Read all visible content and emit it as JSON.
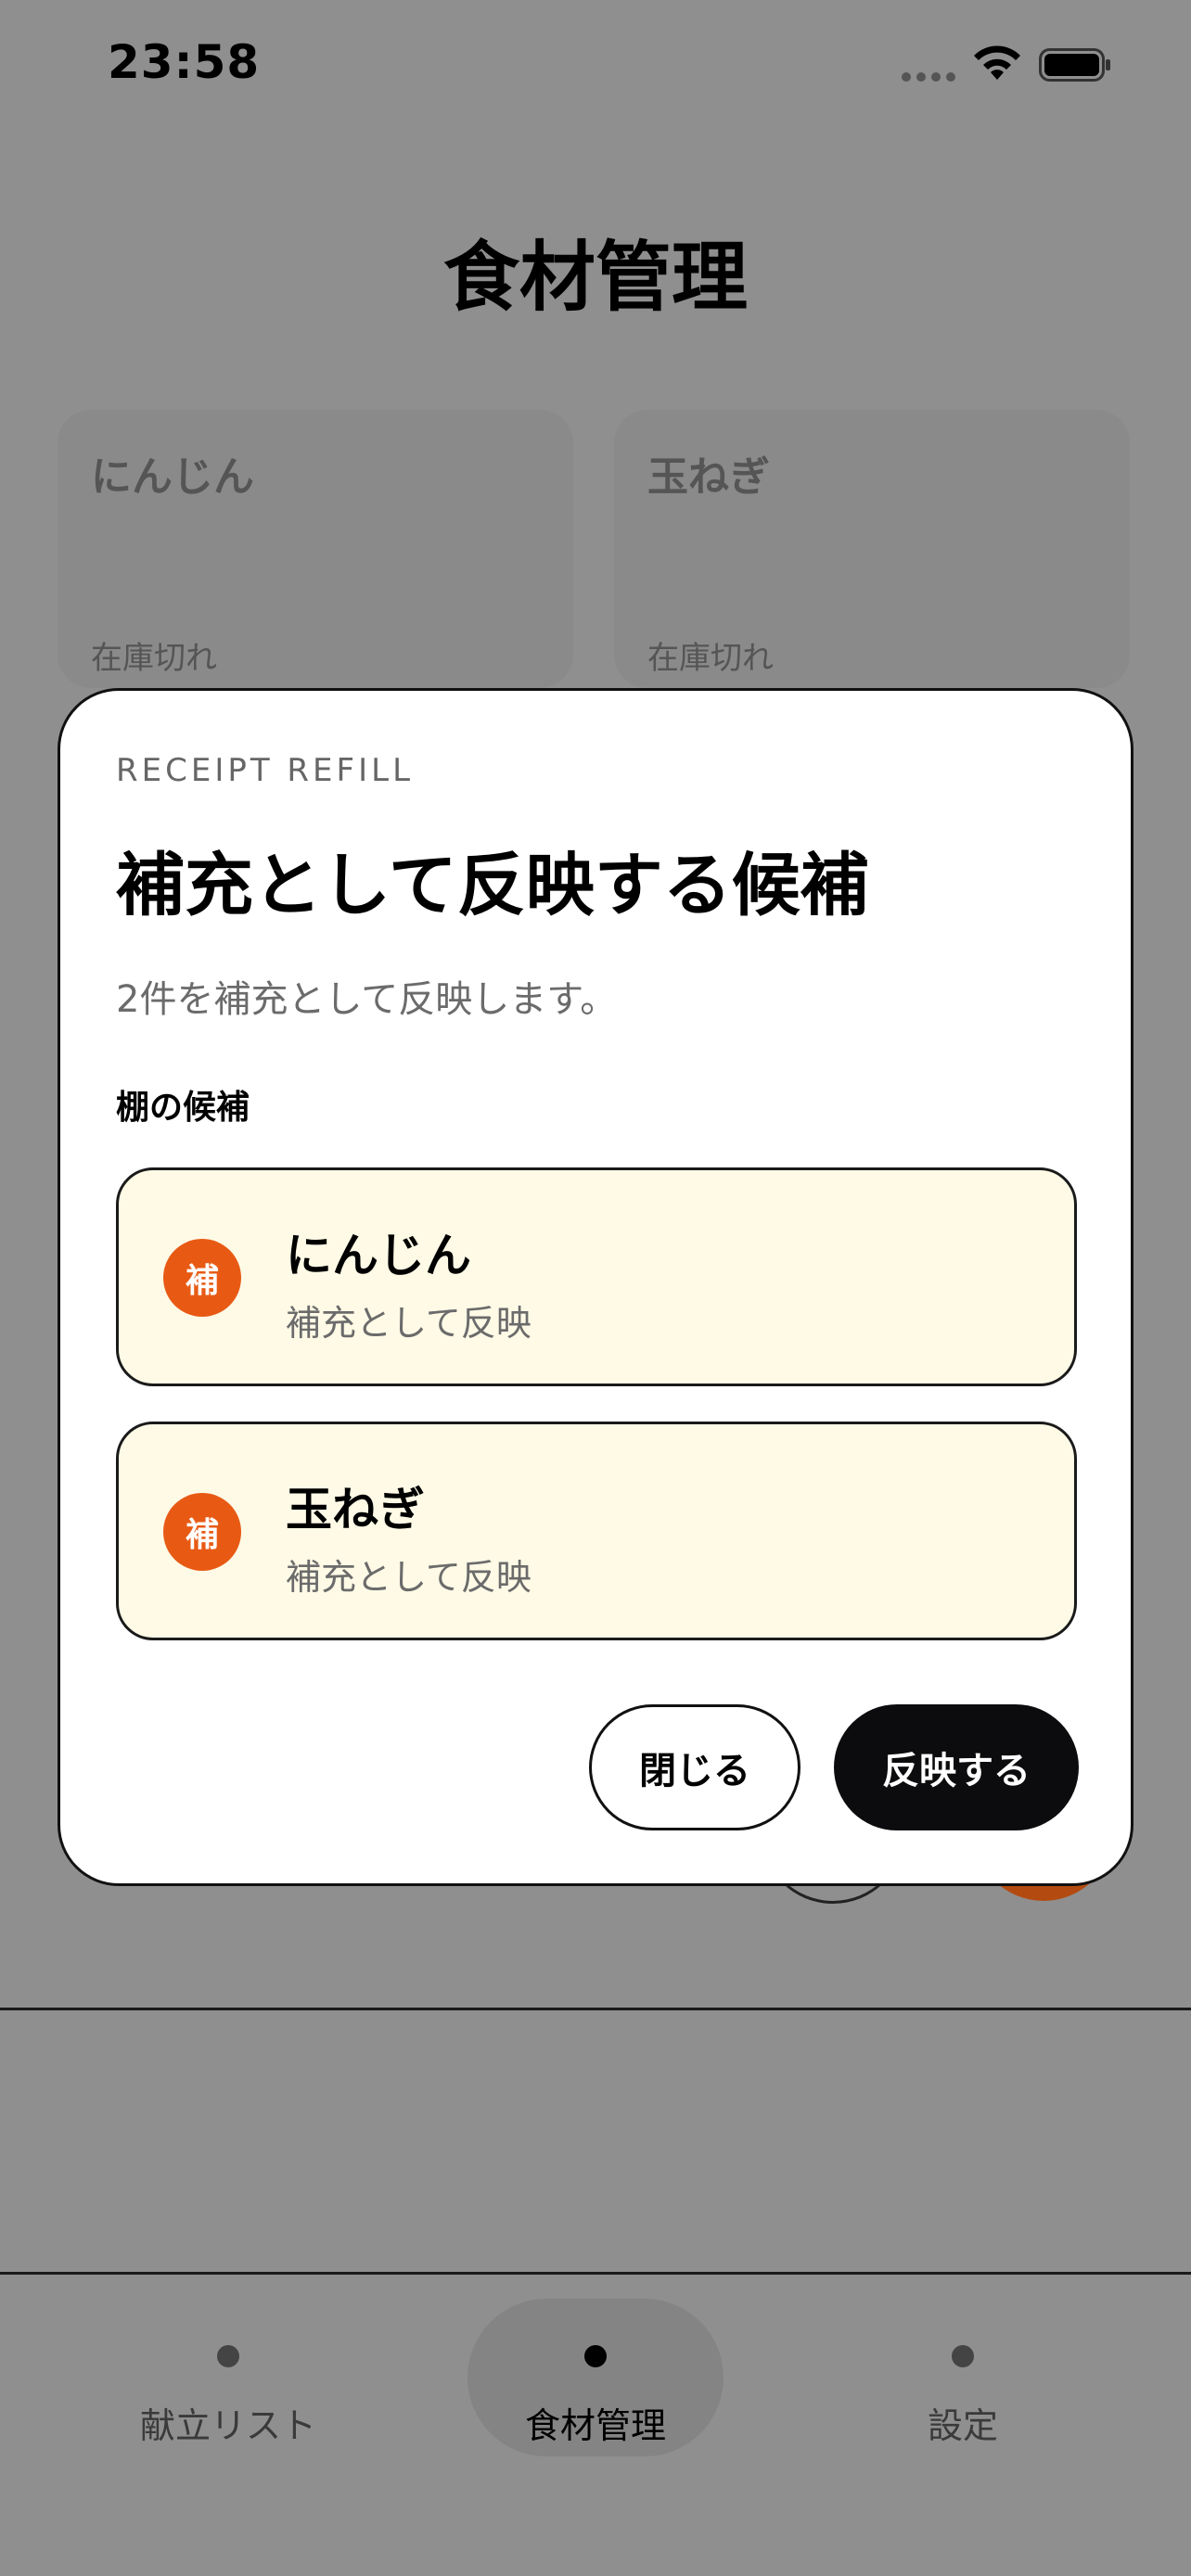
{
  "status_bar": {
    "time": "23:58"
  },
  "page": {
    "title": "食材管理",
    "cards": [
      {
        "name": "にんじん",
        "status": "在庫切れ"
      },
      {
        "name": "玉ねぎ",
        "status": "在庫切れ"
      }
    ]
  },
  "modal": {
    "eyebrow": "RECEIPT REFILL",
    "title": "補充として反映する候補",
    "subtitle": "2件を補充として反映します。",
    "section_label": "棚の候補",
    "candidates": [
      {
        "badge": "補",
        "name": "にんじん",
        "description": "補充として反映"
      },
      {
        "badge": "補",
        "name": "玉ねぎ",
        "description": "補充として反映"
      }
    ],
    "close_label": "閉じる",
    "apply_label": "反映する"
  },
  "tab_bar": {
    "tabs": [
      {
        "label": "献立リスト",
        "active": false
      },
      {
        "label": "食材管理",
        "active": true
      },
      {
        "label": "設定",
        "active": false
      }
    ]
  },
  "colors": {
    "scrim": "#8f8f8f",
    "badge": "#e85a14",
    "candidate_bg": "#fefae6",
    "primary_button": "#0c0c0e"
  },
  "icons": [
    "signal-icon",
    "wifi-icon",
    "battery-icon",
    "tab-dot-icon"
  ]
}
